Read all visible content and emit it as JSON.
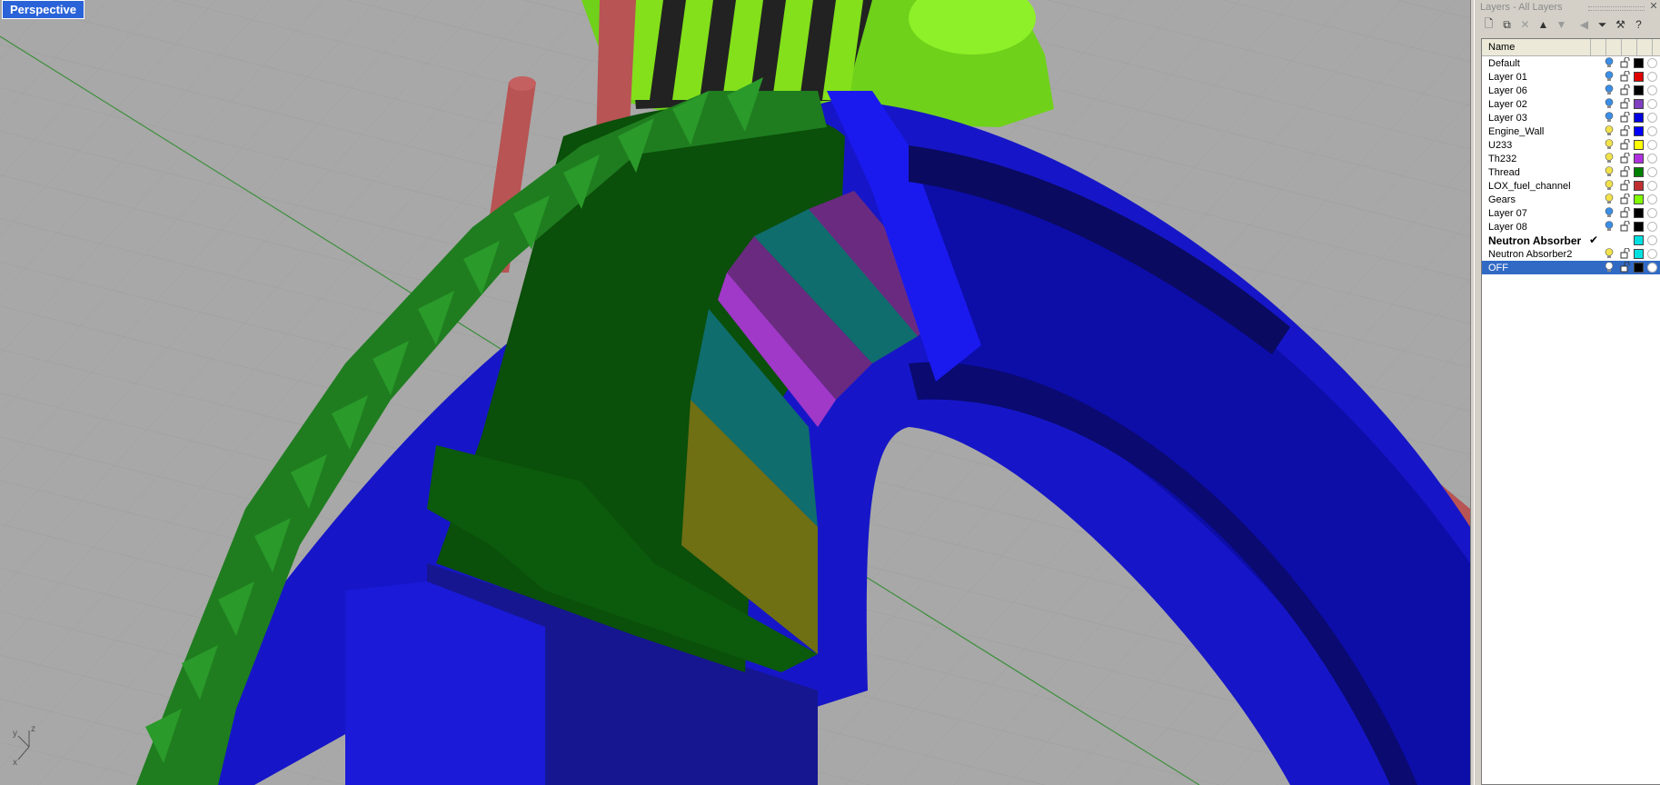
{
  "viewport": {
    "title": "Perspective",
    "axis": {
      "x": "x",
      "y": "y",
      "z": "z"
    }
  },
  "panel": {
    "title": "Layers - All Layers",
    "column_name": "Name",
    "toolbar": [
      "new-layer-icon",
      "new-sublayer-icon",
      "delete-icon",
      "move-up-icon",
      "move-down-icon",
      "move-left-icon",
      "filter-icon",
      "tools-icon",
      "help-icon"
    ],
    "layers": [
      {
        "name": "Default",
        "color": "#000000",
        "on": true,
        "state": "blue"
      },
      {
        "name": "Layer 01",
        "color": "#e00000",
        "on": true,
        "state": "blue"
      },
      {
        "name": "Layer 06",
        "color": "#000000",
        "on": true,
        "state": "blue"
      },
      {
        "name": "Layer 02",
        "color": "#7f3fbf",
        "on": true,
        "state": "blue"
      },
      {
        "name": "Layer 03",
        "color": "#0000e0",
        "on": true,
        "state": "blue"
      },
      {
        "name": "Engine_Wall",
        "color": "#0000ff",
        "on": true,
        "state": "yellow"
      },
      {
        "name": "U233",
        "color": "#ffff00",
        "on": true,
        "state": "yellow"
      },
      {
        "name": "Th232",
        "color": "#b030e0",
        "on": true,
        "state": "yellow"
      },
      {
        "name": "Thread",
        "color": "#008000",
        "on": true,
        "state": "yellow"
      },
      {
        "name": "LOX_fuel_channel",
        "color": "#c03030",
        "on": true,
        "state": "yellow"
      },
      {
        "name": "Gears",
        "color": "#80ff00",
        "on": true,
        "state": "yellow"
      },
      {
        "name": "Layer 07",
        "color": "#000000",
        "on": true,
        "state": "blue"
      },
      {
        "name": "Layer 08",
        "color": "#000000",
        "on": true,
        "state": "blue"
      },
      {
        "name": "Neutron Absorber",
        "color": "#00e0e0",
        "on": true,
        "state": "current"
      },
      {
        "name": "Neutron Absorber2",
        "color": "#00e0e0",
        "on": true,
        "state": "yellow"
      },
      {
        "name": "OFF",
        "color": "#000000",
        "on": false,
        "state": "selected"
      }
    ]
  }
}
